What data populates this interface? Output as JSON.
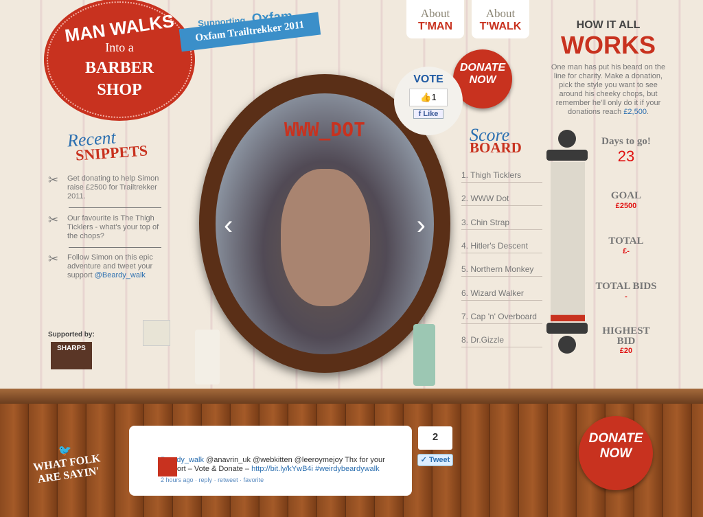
{
  "logo": {
    "line1": "MAN WALKS",
    "line2": "Into a",
    "line3": "BARBER",
    "line4": "SHOP"
  },
  "supporting": {
    "label": "Supporting",
    "org": "Oxfam"
  },
  "ribbon": "Oxfam Trailtrekker 2011",
  "nav": [
    {
      "top": "About",
      "bottom": "T'MAN"
    },
    {
      "top": "About",
      "bottom": "T'WALK"
    }
  ],
  "donate": {
    "line1": "DONATE",
    "line2": "NOW"
  },
  "vote": {
    "title": "VOTE",
    "count": "1",
    "like": "Like"
  },
  "mirror": {
    "style_name": "WWW_DOT",
    "prev": "‹",
    "next": "›"
  },
  "snippets": {
    "title1": "Recent",
    "title2": "SNIPPETS",
    "items": [
      {
        "text": "Get donating to help Simon raise £2500 for Trailtrekker 2011."
      },
      {
        "text": "Our favourite is The Thigh Ticklers - what's your top of the chops?"
      },
      {
        "text": "Follow Simon on this epic adventure and tweet your support ",
        "link": "@Beardy_walk"
      }
    ]
  },
  "supported": {
    "label": "Supported by:",
    "sponsor": "SHARPS"
  },
  "scoreboard": {
    "title1": "Score",
    "title2": "BOARD",
    "items": [
      "1. Thigh Ticklers",
      "2. WWW Dot",
      "3. Chin Strap",
      "4. Hitler's Descent",
      "5. Northern Monkey",
      "6. Wizard Walker",
      "7. Cap 'n' Overboard",
      "8. Dr.Gizzle"
    ]
  },
  "how": {
    "line1": "HOW IT ALL",
    "line2": "WORKS",
    "text": "One man has put his beard on the line for charity. Make a donation, pick the style you want to see around his cheeky chops, but remember he'll only do it if your donations reach ",
    "link": "£2,500",
    "end": "."
  },
  "stats": {
    "days_label": "Days to go!",
    "days": "23",
    "goal_label": "GOAL",
    "goal": "£2500",
    "total_label": "TOTAL",
    "total": "£-",
    "bids_label": "TOTAL BIDS",
    "bids": "-",
    "highest_label1": "HIGHEST",
    "highest_label2": "BID",
    "highest": "£20"
  },
  "progress_percent": 0,
  "footer": {
    "folk1": "WHAT FOLK",
    "folk2": "ARE SAYIN'",
    "tweet": {
      "user": "Beardy_walk",
      "text1": " @anavrin_uk @webkitten @leeroymejoy Thx for your support – Vote & Donate – ",
      "link": "http://bit.ly/kYwB4i",
      "hashtag": "#weirdybeardywalk",
      "time": "2 hours ago",
      "reply": "reply",
      "retweet": "retweet",
      "favorite": "favorite"
    },
    "tweet_count": "2",
    "tweet_button": "Tweet"
  },
  "colors": {
    "red": "#c8321f",
    "blue": "#3b8fc9"
  }
}
